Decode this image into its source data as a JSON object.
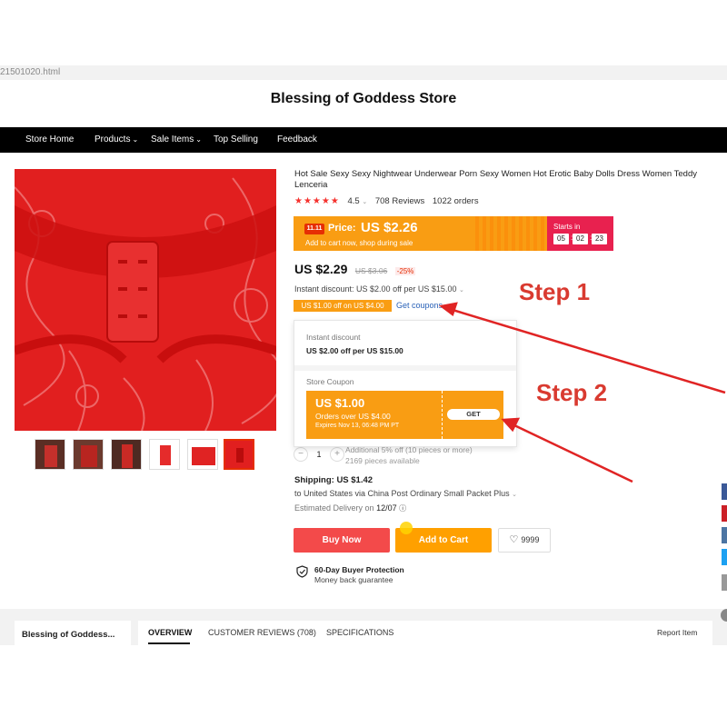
{
  "browser": {
    "url_fragment": "21501020.html"
  },
  "store": {
    "name": "Blessing of Goddess Store"
  },
  "nav": [
    {
      "label": "Store Home",
      "has_dropdown": false
    },
    {
      "label": "Products",
      "has_dropdown": true
    },
    {
      "label": "Sale Items",
      "has_dropdown": true
    },
    {
      "label": "Top Selling",
      "has_dropdown": false
    },
    {
      "label": "Feedback",
      "has_dropdown": false
    }
  ],
  "product": {
    "title": "Hot Sale Sexy Sexy Nightwear Underwear Porn Sexy Women Hot Erotic Baby Dolls Dress Women Teddy Lenceria",
    "rating": {
      "stars": "★★★★★",
      "score": "4.5",
      "reviews": "708 Reviews",
      "orders": "1022 orders"
    },
    "thumbnail_count": 6
  },
  "promo_banner": {
    "badge": "11.11",
    "price_label": "Price:",
    "price": "US $2.26",
    "subtitle": "Add to cart now, shop during sale",
    "starts_in_label": "Starts in",
    "timer": {
      "hours": "05",
      "minutes": "02",
      "seconds": "23"
    },
    "colors": {
      "banner": "#f99d13",
      "timer": "#e8214f"
    }
  },
  "pricing": {
    "current": "US $2.29",
    "original": "US $3.06",
    "discount": "-25%",
    "instant_discount": "Instant discount: US $2.00 off per US $15.00",
    "coupon_tag": "US $1.00 off on US $4.00",
    "get_coupons": "Get coupons"
  },
  "coupon_popup": {
    "instant_label": "Instant discount",
    "instant_value": "US $2.00 off per US $15.00",
    "store_coupon_label": "Store Coupon",
    "coupon": {
      "amount": "US $1.00",
      "condition": "Orders over US $4.00",
      "expires": "Expires Nov 13, 06:48 PM PT",
      "button": "GET"
    }
  },
  "quantity": {
    "minus": "−",
    "value": "1",
    "plus": "+",
    "note": "Additional 5% off (10 pieces or more)",
    "available": "2169 pieces available"
  },
  "shipping": {
    "label": "Shipping:",
    "cost": "US $1.42",
    "via": "to United States via China Post Ordinary Small Packet Plus",
    "delivery_label": "Estimated Delivery on",
    "delivery_date": "12/07"
  },
  "actions": {
    "buy_now": "Buy Now",
    "add_to_cart": "Add to Cart",
    "wishlist_count": "9999",
    "colors": {
      "buy_now": "#f34a4a",
      "add_to_cart": "#ffa000"
    }
  },
  "protection": {
    "title": "60-Day Buyer Protection",
    "subtitle": "Money back guarantee"
  },
  "bottom": {
    "store_short": "Blessing of Goddess...",
    "tabs": [
      "OVERVIEW",
      "CUSTOMER REVIEWS (708)",
      "SPECIFICATIONS"
    ],
    "report": "Report Item"
  },
  "annotations": {
    "step1": "Step 1",
    "step2": "Step 2",
    "color": "#d93a30"
  }
}
